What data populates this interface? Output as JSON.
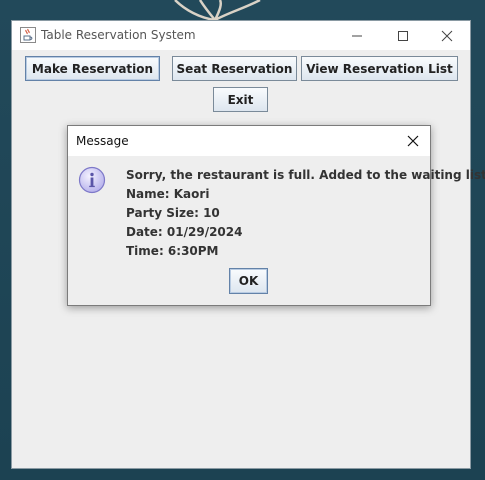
{
  "window": {
    "title": "Table Reservation System",
    "controls": {
      "minimize_icon": "minimize-icon",
      "maximize_icon": "maximize-icon",
      "close_icon": "close-icon"
    }
  },
  "toolbar": {
    "make_reservation_label": "Make Reservation",
    "seat_reservation_label": "Seat Reservation",
    "view_list_label": "View Reservation List",
    "exit_label": "Exit"
  },
  "dialog": {
    "title": "Message",
    "icon": "info-icon",
    "lines": [
      "Sorry, the restaurant is full. Added to the waiting list.",
      "Name: Kaori",
      "Party Size: 10",
      "Date: 01/29/2024",
      "Time: 6:30PM"
    ],
    "ok_label": "OK"
  },
  "colors": {
    "desktop": "#1f4858",
    "window_bg": "#eeeeee",
    "titlebar": "#ffffff",
    "button_border": "#7a8a99",
    "info_icon": "#7d78c8"
  }
}
